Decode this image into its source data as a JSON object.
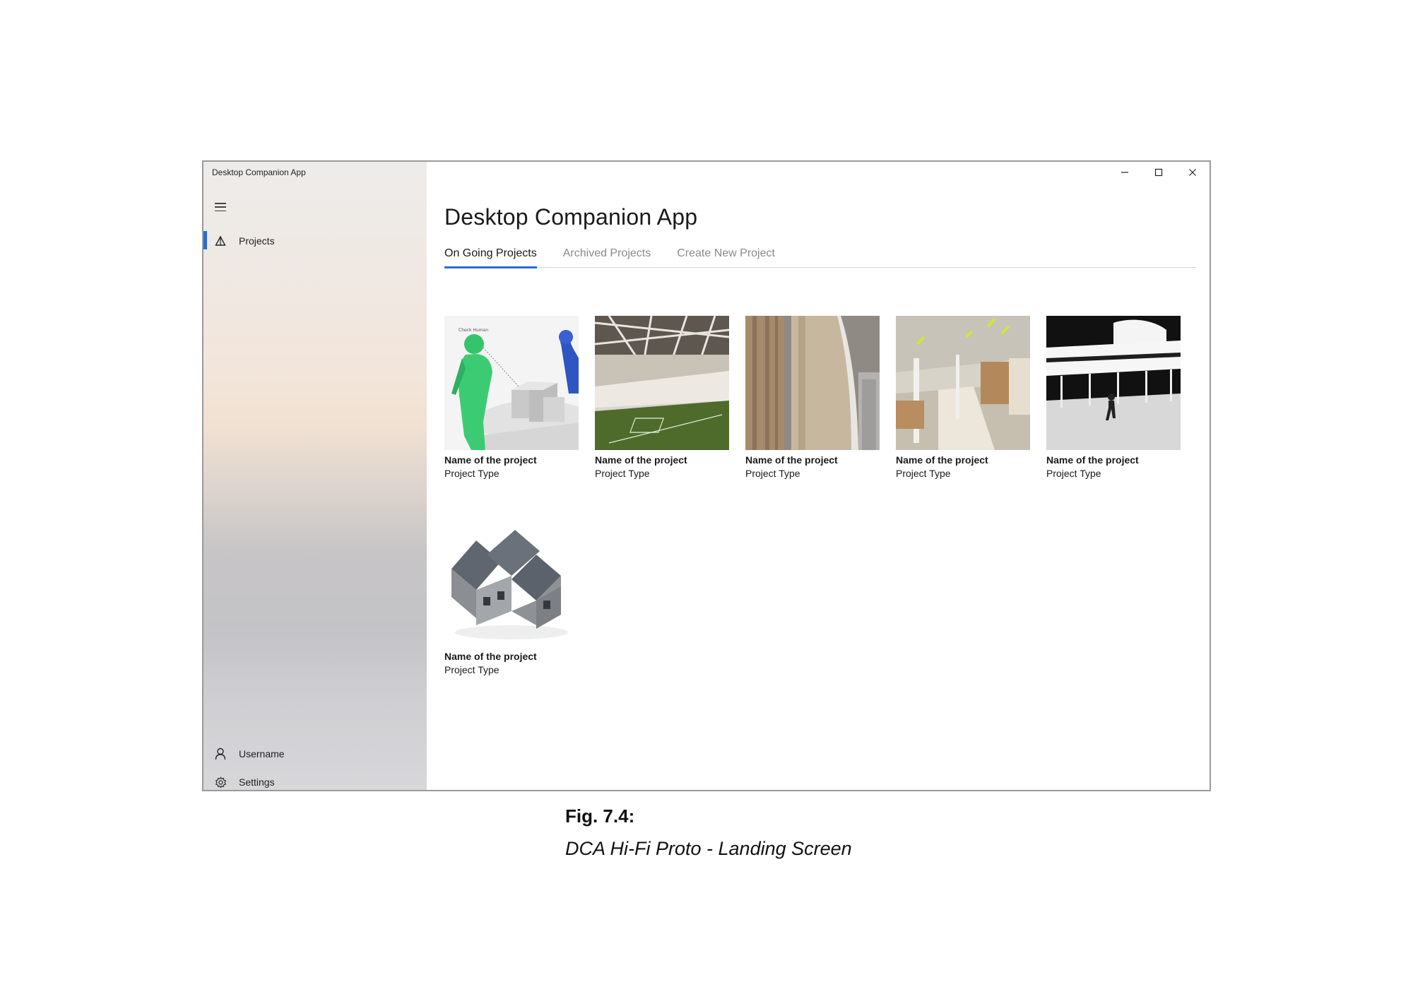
{
  "window": {
    "title": "Desktop Companion App"
  },
  "sidebar": {
    "items": [
      {
        "label": "Projects",
        "icon": "projects-icon",
        "active": true
      }
    ],
    "footer": [
      {
        "label": "Username",
        "icon": "user-icon"
      },
      {
        "label": "Settings",
        "icon": "gear-icon"
      }
    ],
    "accent": "#2a6bd2"
  },
  "main": {
    "title": "Desktop Companion App",
    "tabs": [
      {
        "label": "On Going Projects",
        "active": true
      },
      {
        "label": "Archived Projects",
        "active": false
      },
      {
        "label": "Create New Project",
        "active": false
      }
    ],
    "projects": [
      {
        "name": "Name of the project",
        "type": "Project Type",
        "thumbnail": "human-figures-model"
      },
      {
        "name": "Name of the project",
        "type": "Project Type",
        "thumbnail": "stadium"
      },
      {
        "name": "Name of the project",
        "type": "Project Type",
        "thumbnail": "towers"
      },
      {
        "name": "Name of the project",
        "type": "Project Type",
        "thumbnail": "office-interior"
      },
      {
        "name": "Name of the project",
        "type": "Project Type",
        "thumbnail": "modernist-villa"
      },
      {
        "name": "Name of the project",
        "type": "Project Type",
        "thumbnail": "house-model"
      }
    ]
  },
  "caption": {
    "label": "Fig. 7.4:",
    "text": "DCA Hi-Fi Proto - Landing Screen"
  }
}
